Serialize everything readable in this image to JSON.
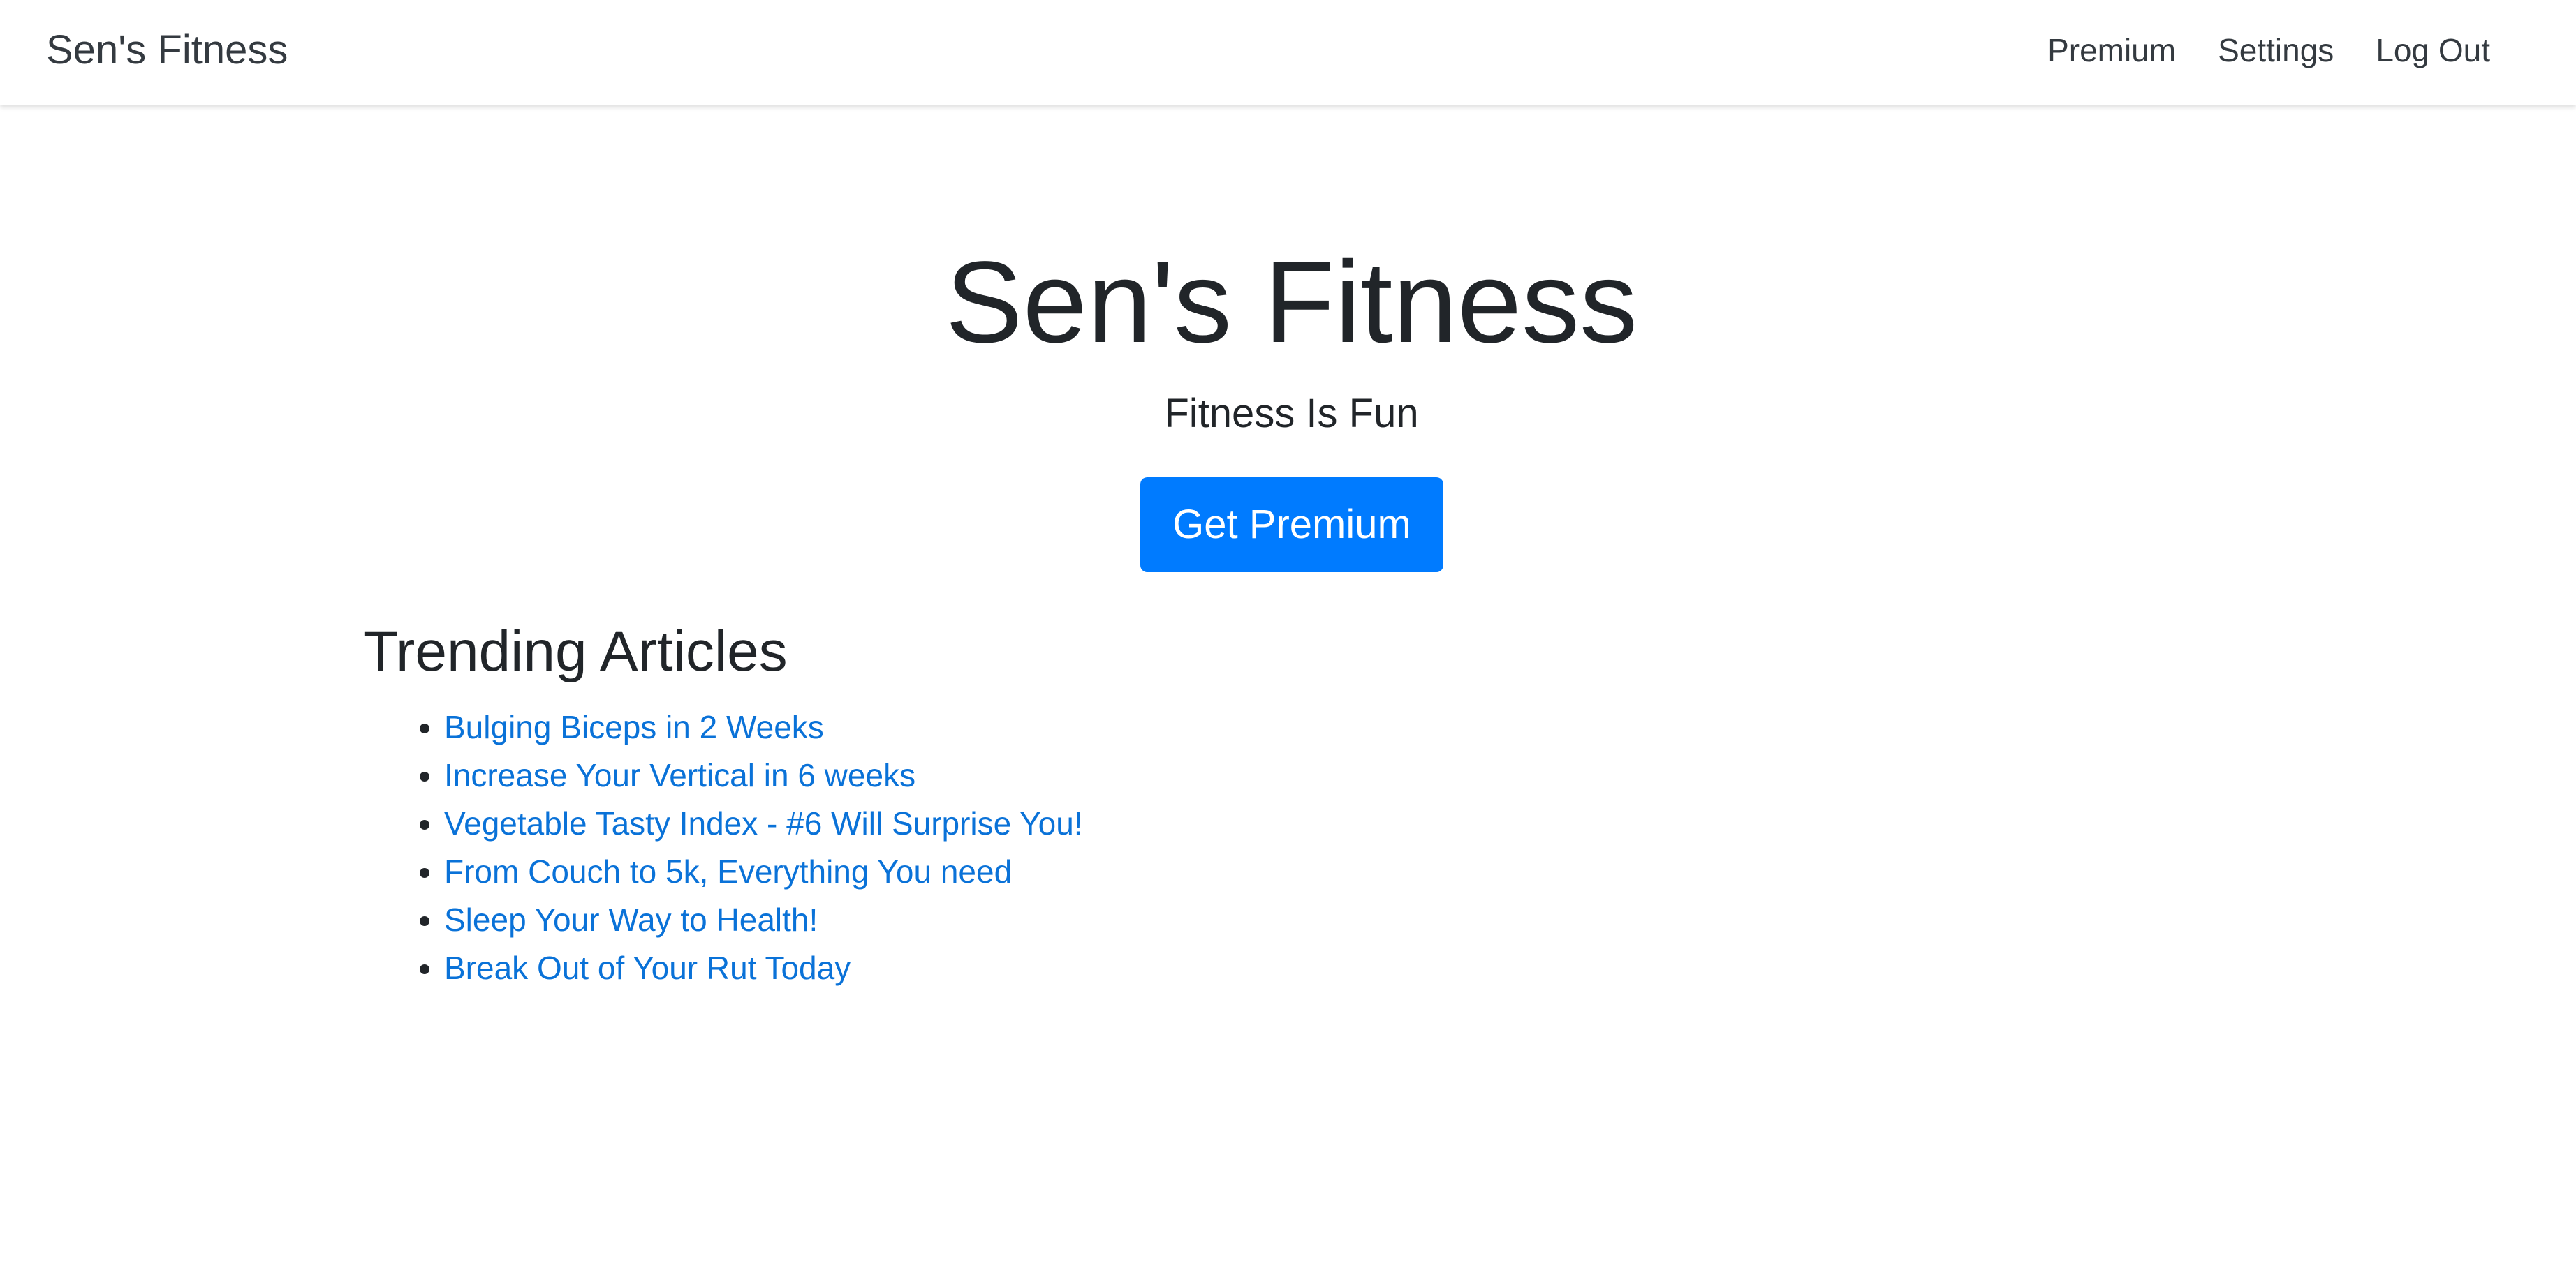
{
  "navbar": {
    "brand": "Sen's Fitness",
    "links": [
      "Premium",
      "Settings",
      "Log Out"
    ]
  },
  "hero": {
    "title": "Sen's Fitness",
    "subtitle": "Fitness Is Fun",
    "button_label": "Get Premium"
  },
  "articles": {
    "heading": "Trending Articles",
    "items": [
      "Bulging Biceps in 2 Weeks",
      "Increase Your Vertical in 6 weeks",
      "Vegetable Tasty Index - #6 Will Surprise You!",
      "From Couch to 5k, Everything You need",
      "Sleep Your Way to Health!",
      "Break Out of Your Rut Today"
    ]
  },
  "colors": {
    "primary_button": "#007bff",
    "link": "#0a72d8",
    "text": "#212529",
    "nav_text": "#343a40"
  }
}
